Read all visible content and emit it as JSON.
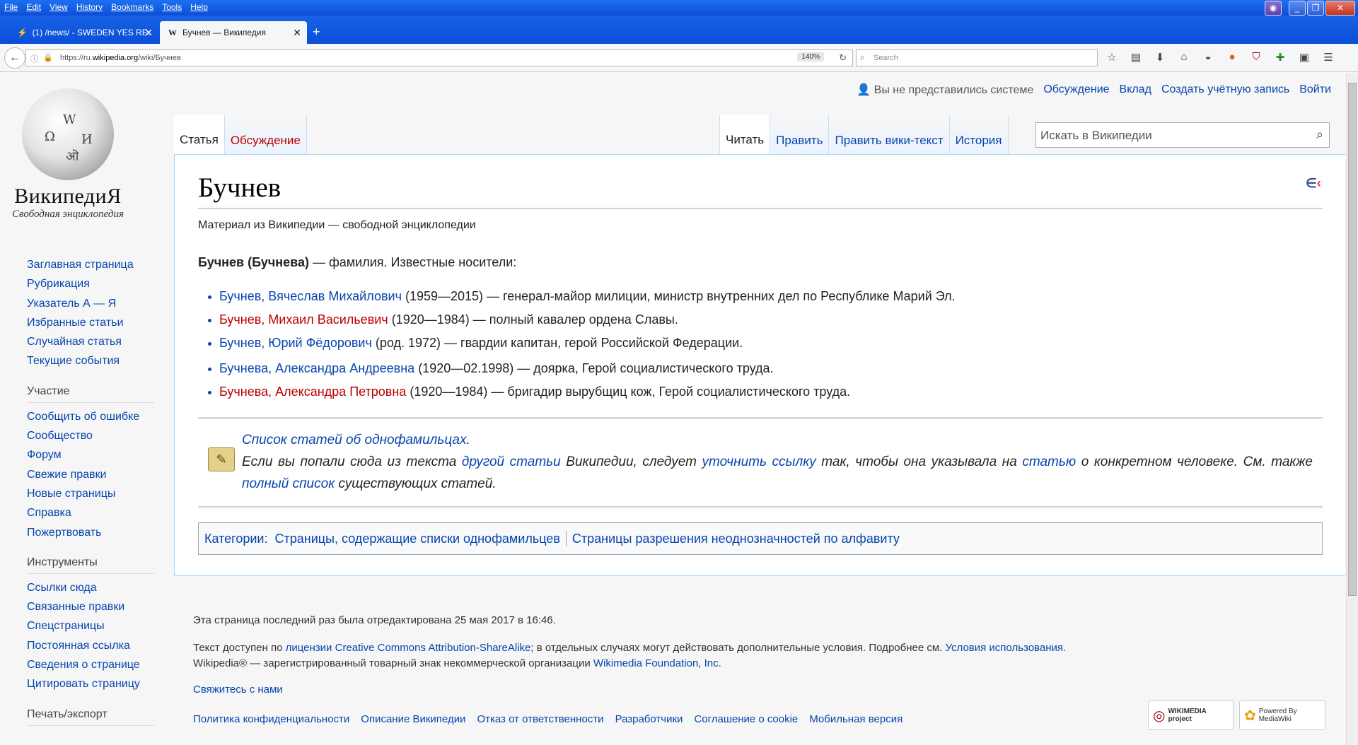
{
  "browser": {
    "menu": [
      "File",
      "Edit",
      "View",
      "History",
      "Bookmarks",
      "Tools",
      "Help"
    ],
    "tabs": [
      {
        "title": "(1) /news/ - SWEDEN YES RE..."
      },
      {
        "title": "Бучнев — Википедия"
      }
    ],
    "url_prefix": "https://ru.",
    "url_domain": "wikipedia.org",
    "url_path": "/wiki/Бучнев",
    "zoom": "140%",
    "search_placeholder": "Search"
  },
  "logo": {
    "wordmark": "ВикипедиЯ",
    "tagline": "Свободная энциклопедия"
  },
  "personal": {
    "status": "Вы не представились системе",
    "links": [
      "Обсуждение",
      "Вклад",
      "Создать учётную запись",
      "Войти"
    ]
  },
  "tabs": {
    "article": "Статья",
    "talk": "Обсуждение",
    "read": "Читать",
    "edit": "Править",
    "edit_source": "Править вики-текст",
    "history": "История"
  },
  "search": {
    "placeholder": "Искать в Википедии"
  },
  "sidebar": {
    "nav": [
      "Заглавная страница",
      "Рубрикация",
      "Указатель А — Я",
      "Избранные статьи",
      "Случайная статья",
      "Текущие события"
    ],
    "participation_heading": "Участие",
    "participation": [
      "Сообщить об ошибке",
      "Сообщество",
      "Форум",
      "Свежие правки",
      "Новые страницы",
      "Справка",
      "Пожертвовать"
    ],
    "tools_heading": "Инструменты",
    "tools": [
      "Ссылки сюда",
      "Связанные правки",
      "Спецстраницы",
      "Постоянная ссылка",
      "Сведения о странице",
      "Цитировать страницу"
    ],
    "print_heading": "Печать/экспорт"
  },
  "article": {
    "title": "Бучнев",
    "sitesub": "Материал из Википедии — свободной энциклопедии",
    "lead_bold": "Бучнев (Бучнева)",
    "lead_rest": " — фамилия. Известные носители:",
    "items": [
      {
        "name": "Бучнев, Вячеслав Михайлович",
        "desc": " (1959—2015) — генерал-майор милиции, министр внутренних дел по Республике Марий Эл."
      },
      {
        "name": "Бучнев, Михаил Васильевич",
        "desc": " (1920—1984) — полный кавалер ордена Славы."
      },
      {
        "name": "Бучнев, Юрий Фёдорович",
        "desc": " (род. 1972) — гвардии капитан, герой Российской Федерации."
      },
      {
        "name": "Бучнева, Александра Андреевна",
        "desc": " (1920—02.1998) — доярка, Герой социалистического труда."
      },
      {
        "name": "Бучнева, Александра Петровна",
        "desc": " (1920—1984) — бригадир вырубщиц кож, Герой социалистического труда."
      }
    ],
    "link_colors": {
      "existing": "#0645ad",
      "missing": "#ba0000"
    }
  },
  "disambig": {
    "list_link": "Список статей об однофамильцах",
    "t1": "Если вы попали сюда из текста ",
    "l1": "другой статьи",
    "t2": " Википедии, следует ",
    "l2": "уточнить ссылку",
    "t3": " так, чтобы она указывала на ",
    "l3": "статью",
    "t4": " о конкретном человеке. См. также ",
    "l4": "полный список",
    "t5": " существующих статей."
  },
  "categories": {
    "label": "Категории:",
    "items": [
      "Страницы, содержащие списки однофамильцев",
      "Страницы разрешения неоднозначностей по алфавиту"
    ]
  },
  "footer": {
    "lastmod": "Эта страница последний раз была отредактирована 25 мая 2017 в 16:46.",
    "license_pre": "Текст доступен по ",
    "license_link": "лицензии Creative Commons Attribution-ShareAlike",
    "license_mid": "; в отдельных случаях могут действовать дополнительные условия. Подробнее см. ",
    "terms_link": "Условия использования.",
    "trademark_pre": "Wikipedia® — зарегистрированный товарный знак некоммерческой организации ",
    "trademark_link": "Wikimedia Foundation, Inc.",
    "contact": "Свяжитесь с нами",
    "places": [
      "Политика конфиденциальности",
      "Описание Википедии",
      "Отказ от ответственности",
      "Разработчики",
      "Соглашение о cookie",
      "Мобильная версия"
    ],
    "badge_wikimedia": "WIKIMEDIA project",
    "badge_mediawiki": "Powered By MediaWiki"
  }
}
